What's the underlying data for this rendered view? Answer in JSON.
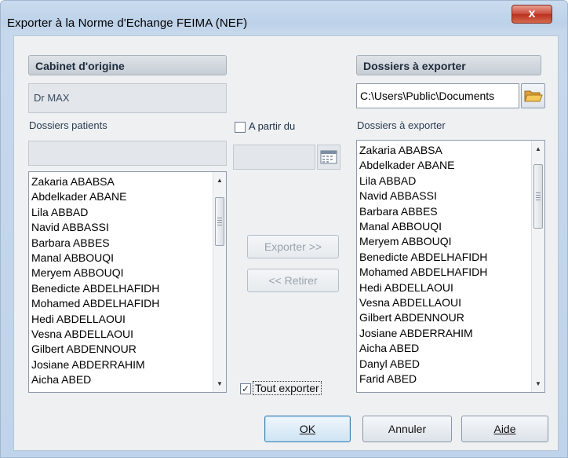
{
  "window": {
    "title": "Exporter à la Norme d'Echange FEIMA (NEF)",
    "close_label": "x"
  },
  "left": {
    "group_header": "Cabinet d'origine",
    "origin_value": "Dr MAX",
    "patients_label": "Dossiers patients",
    "patients_filter_value": "",
    "patients": [
      "Zakaria ABABSA",
      "Abdelkader ABANE",
      "Lila ABBAD",
      "Navid ABBASSI",
      "Barbara ABBES",
      "Manal ABBOUQI",
      "Meryem ABBOUQI",
      "Benedicte ABDELHAFIDH",
      "Mohamed ABDELHAFIDH",
      "Hedi ABDELLAOUI",
      "Vesna ABDELLAOUI",
      "Gilbert ABDENNOUR",
      "Josiane ABDERRAHIM",
      "Aicha ABED"
    ]
  },
  "middle": {
    "from_date_label": "A partir du",
    "from_date_checked": false,
    "date_value": "",
    "export_button": "Exporter >>",
    "remove_button": "<< Retirer",
    "export_all_label": "Tout exporter",
    "export_all_checked": true
  },
  "right": {
    "group_header": "Dossiers à exporter",
    "path_value": "C:\\Users\\Public\\Documents",
    "list_label": "Dossiers à exporter",
    "exports": [
      "Zakaria ABABSA",
      "Abdelkader ABANE",
      "Lila ABBAD",
      "Navid ABBASSI",
      "Barbara ABBES",
      "Manal ABBOUQI",
      "Meryem ABBOUQI",
      "Benedicte ABDELHAFIDH",
      "Mohamed ABDELHAFIDH",
      "Hedi ABDELLAOUI",
      "Vesna ABDELLAOUI",
      "Gilbert ABDENNOUR",
      "Josiane ABDERRAHIM",
      "Aicha ABED",
      "Danyl ABED",
      "Farid ABED"
    ]
  },
  "footer": {
    "ok_label": "OK",
    "cancel_label": "Annuler",
    "help_label": "Aide"
  },
  "icons": {
    "folder": "folder-open-icon",
    "calendar": "calendar-icon",
    "close": "close-icon",
    "scroll_up": "arrow-up-icon",
    "scroll_down": "arrow-down-icon",
    "check": "checkmark-icon"
  },
  "colors": {
    "close_button": "#c9483a",
    "window_frame": "#bfd3ea",
    "client_background": "#eef0f2"
  }
}
